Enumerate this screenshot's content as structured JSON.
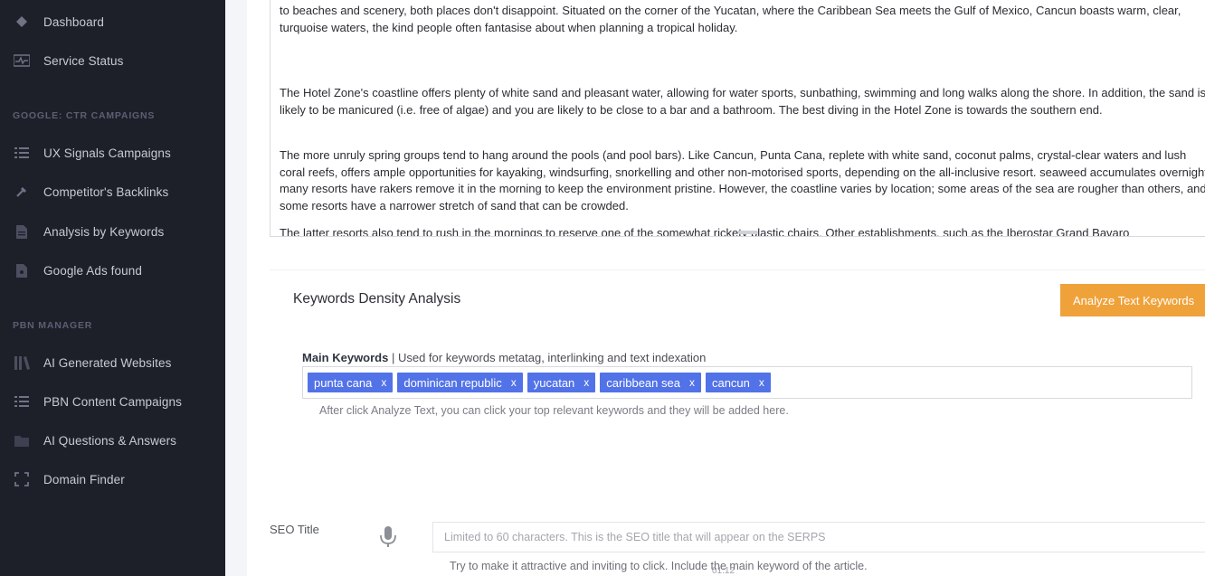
{
  "sidebar": {
    "items_top": [
      {
        "label": "Dashboard",
        "icon": "dashboard-icon"
      },
      {
        "label": "Service Status",
        "icon": "pulse-icon"
      }
    ],
    "section_ctr": "GOOGLE: CTR CAMPAIGNS",
    "items_ctr": [
      {
        "label": "UX Signals Campaigns",
        "icon": "list-icon"
      },
      {
        "label": "Competitor's Backlinks",
        "icon": "link-icon"
      },
      {
        "label": "Analysis by Keywords",
        "icon": "document-icon"
      },
      {
        "label": "Google Ads found",
        "icon": "ads-icon"
      }
    ],
    "section_pbn": "PBN MANAGER",
    "items_pbn": [
      {
        "label": "AI Generated Websites",
        "icon": "books-icon"
      },
      {
        "label": "PBN Content Campaigns",
        "icon": "list-icon"
      },
      {
        "label": "AI Questions & Answers",
        "icon": "folder-icon"
      },
      {
        "label": "Domain Finder",
        "icon": "expand-icon"
      }
    ]
  },
  "editor": {
    "p1": "to beaches and scenery, both places don't disappoint. Situated on the corner of the Yucatan, where the Caribbean Sea meets the Gulf of Mexico, Cancun boasts warm, clear, turquoise waters, the kind people often fantasise about when planning a tropical holiday.",
    "p2": "The Hotel Zone's coastline offers plenty of white sand and pleasant water, allowing for water sports, sunbathing, swimming and long walks along the shore. In addition, the sand is likely to be manicured (i.e. free of algae) and you are likely to be close to a bar and a bathroom. The best diving in the Hotel Zone is towards the southern end.",
    "p3": "The more unruly spring groups tend to hang around the pools (and pool bars). Like Cancun, Punta Cana, replete with white sand, coconut palms, crystal-clear waters and lush coral reefs, offers ample opportunities for kayaking, windsurfing, snorkelling and other non-motorised sports, depending on the all-inclusive resort. seaweed accumulates overnight, many resorts have rakers remove it in the morning to keep the environment pristine. However, the coastline varies by location; some areas of the sea are rougher than others, and some resorts have a narrower stretch of sand that can be crowded.",
    "p4": "The latter resorts also tend to rush in the mornings to reserve one of the somewhat rickety plastic chairs. Other establishments, such as the Iberostar Grand Bavaro"
  },
  "kda": {
    "title": "Keywords Density Analysis",
    "analyze_button": "Analyze Text Keywords",
    "main_keywords_label": "Main Keywords",
    "main_keywords_desc": " | Used for keywords metatag, interlinking and text indexation",
    "tags": [
      "punta cana",
      "dominican republic",
      "yucatan",
      "caribbean sea",
      "cancun"
    ],
    "tag_remove": "x",
    "hint": "After click Analyze Text, you can click your top relevant keywords and they will be added here."
  },
  "seo": {
    "label": "SEO Title",
    "placeholder": "Limited to 60 characters. This is the SEO title that will appear on the SERPS",
    "hint": "Try to make it attractive and inviting to click. Include the main keyword of the article.",
    "timestamp": "01:12"
  }
}
